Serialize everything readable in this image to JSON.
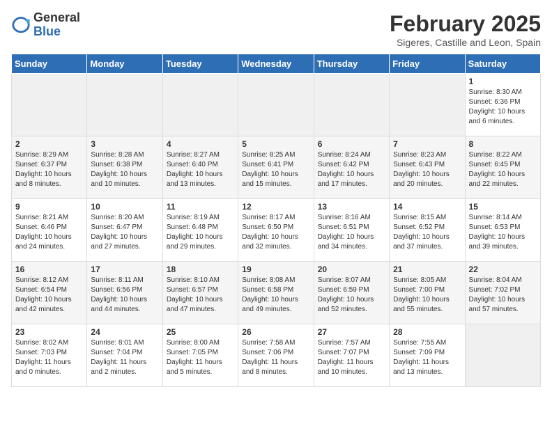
{
  "logo": {
    "general": "General",
    "blue": "Blue"
  },
  "header": {
    "month_year": "February 2025",
    "location": "Sigeres, Castille and Leon, Spain"
  },
  "days_of_week": [
    "Sunday",
    "Monday",
    "Tuesday",
    "Wednesday",
    "Thursday",
    "Friday",
    "Saturday"
  ],
  "weeks": [
    [
      {
        "day": "",
        "info": ""
      },
      {
        "day": "",
        "info": ""
      },
      {
        "day": "",
        "info": ""
      },
      {
        "day": "",
        "info": ""
      },
      {
        "day": "",
        "info": ""
      },
      {
        "day": "",
        "info": ""
      },
      {
        "day": "1",
        "info": "Sunrise: 8:30 AM\nSunset: 6:36 PM\nDaylight: 10 hours\nand 6 minutes."
      }
    ],
    [
      {
        "day": "2",
        "info": "Sunrise: 8:29 AM\nSunset: 6:37 PM\nDaylight: 10 hours\nand 8 minutes."
      },
      {
        "day": "3",
        "info": "Sunrise: 8:28 AM\nSunset: 6:38 PM\nDaylight: 10 hours\nand 10 minutes."
      },
      {
        "day": "4",
        "info": "Sunrise: 8:27 AM\nSunset: 6:40 PM\nDaylight: 10 hours\nand 13 minutes."
      },
      {
        "day": "5",
        "info": "Sunrise: 8:25 AM\nSunset: 6:41 PM\nDaylight: 10 hours\nand 15 minutes."
      },
      {
        "day": "6",
        "info": "Sunrise: 8:24 AM\nSunset: 6:42 PM\nDaylight: 10 hours\nand 17 minutes."
      },
      {
        "day": "7",
        "info": "Sunrise: 8:23 AM\nSunset: 6:43 PM\nDaylight: 10 hours\nand 20 minutes."
      },
      {
        "day": "8",
        "info": "Sunrise: 8:22 AM\nSunset: 6:45 PM\nDaylight: 10 hours\nand 22 minutes."
      }
    ],
    [
      {
        "day": "9",
        "info": "Sunrise: 8:21 AM\nSunset: 6:46 PM\nDaylight: 10 hours\nand 24 minutes."
      },
      {
        "day": "10",
        "info": "Sunrise: 8:20 AM\nSunset: 6:47 PM\nDaylight: 10 hours\nand 27 minutes."
      },
      {
        "day": "11",
        "info": "Sunrise: 8:19 AM\nSunset: 6:48 PM\nDaylight: 10 hours\nand 29 minutes."
      },
      {
        "day": "12",
        "info": "Sunrise: 8:17 AM\nSunset: 6:50 PM\nDaylight: 10 hours\nand 32 minutes."
      },
      {
        "day": "13",
        "info": "Sunrise: 8:16 AM\nSunset: 6:51 PM\nDaylight: 10 hours\nand 34 minutes."
      },
      {
        "day": "14",
        "info": "Sunrise: 8:15 AM\nSunset: 6:52 PM\nDaylight: 10 hours\nand 37 minutes."
      },
      {
        "day": "15",
        "info": "Sunrise: 8:14 AM\nSunset: 6:53 PM\nDaylight: 10 hours\nand 39 minutes."
      }
    ],
    [
      {
        "day": "16",
        "info": "Sunrise: 8:12 AM\nSunset: 6:54 PM\nDaylight: 10 hours\nand 42 minutes."
      },
      {
        "day": "17",
        "info": "Sunrise: 8:11 AM\nSunset: 6:56 PM\nDaylight: 10 hours\nand 44 minutes."
      },
      {
        "day": "18",
        "info": "Sunrise: 8:10 AM\nSunset: 6:57 PM\nDaylight: 10 hours\nand 47 minutes."
      },
      {
        "day": "19",
        "info": "Sunrise: 8:08 AM\nSunset: 6:58 PM\nDaylight: 10 hours\nand 49 minutes."
      },
      {
        "day": "20",
        "info": "Sunrise: 8:07 AM\nSunset: 6:59 PM\nDaylight: 10 hours\nand 52 minutes."
      },
      {
        "day": "21",
        "info": "Sunrise: 8:05 AM\nSunset: 7:00 PM\nDaylight: 10 hours\nand 55 minutes."
      },
      {
        "day": "22",
        "info": "Sunrise: 8:04 AM\nSunset: 7:02 PM\nDaylight: 10 hours\nand 57 minutes."
      }
    ],
    [
      {
        "day": "23",
        "info": "Sunrise: 8:02 AM\nSunset: 7:03 PM\nDaylight: 11 hours\nand 0 minutes."
      },
      {
        "day": "24",
        "info": "Sunrise: 8:01 AM\nSunset: 7:04 PM\nDaylight: 11 hours\nand 2 minutes."
      },
      {
        "day": "25",
        "info": "Sunrise: 8:00 AM\nSunset: 7:05 PM\nDaylight: 11 hours\nand 5 minutes."
      },
      {
        "day": "26",
        "info": "Sunrise: 7:58 AM\nSunset: 7:06 PM\nDaylight: 11 hours\nand 8 minutes."
      },
      {
        "day": "27",
        "info": "Sunrise: 7:57 AM\nSunset: 7:07 PM\nDaylight: 11 hours\nand 10 minutes."
      },
      {
        "day": "28",
        "info": "Sunrise: 7:55 AM\nSunset: 7:09 PM\nDaylight: 11 hours\nand 13 minutes."
      },
      {
        "day": "",
        "info": ""
      }
    ]
  ]
}
